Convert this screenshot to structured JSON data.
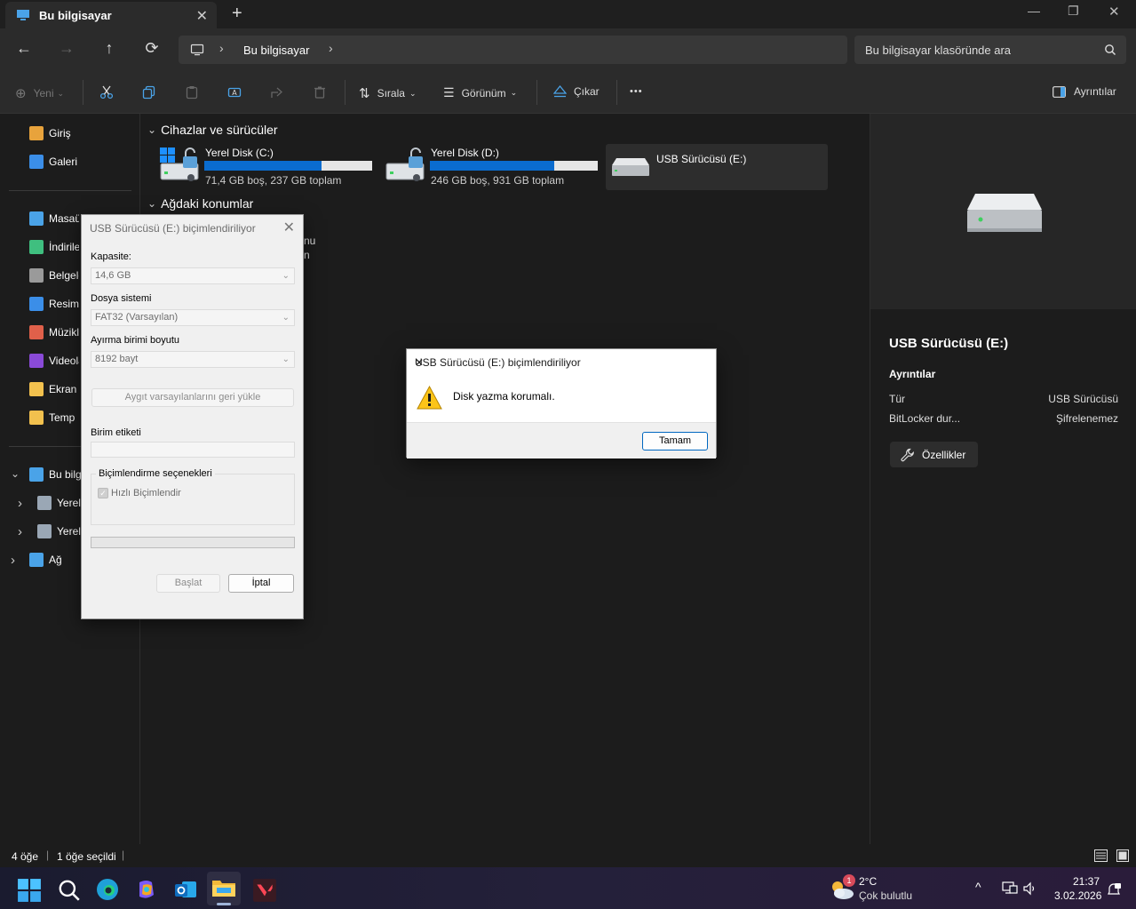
{
  "window": {
    "tab_title": "Bu bilgisayar",
    "new_tab": "+",
    "close_tab": "✕",
    "minimize": "—",
    "maximize": "❐",
    "close": "✕"
  },
  "nav": {
    "back": "←",
    "forward": "→",
    "up": "↑",
    "refresh": "⟳",
    "breadcrumb": "Bu bilgisayar",
    "search_placeholder": "Bu bilgisayar klasöründe ara"
  },
  "toolbar": {
    "new_label": "Yeni",
    "sort_label": "Sırala",
    "view_label": "Görünüm",
    "eject_label": "Çıkar",
    "more_label": "•••",
    "details_label": "Ayrıntılar"
  },
  "sidebar": {
    "top_items": [
      {
        "label": "Giriş",
        "icon": "home-icon",
        "color": "#e8a33c"
      },
      {
        "label": "Galeri",
        "icon": "gallery-icon",
        "color": "#3b8ee8"
      }
    ],
    "quick_items": [
      {
        "label": "Masaüstü",
        "icon": "desktop-icon",
        "color": "#4aa3e8"
      },
      {
        "label": "İndirilenler",
        "icon": "download-icon",
        "color": "#3fbf7f"
      },
      {
        "label": "Belgeler",
        "icon": "documents-icon",
        "color": "#9a9a9a"
      },
      {
        "label": "Resimler",
        "icon": "pictures-icon",
        "color": "#3b8ee8"
      },
      {
        "label": "Müzikler",
        "icon": "music-icon",
        "color": "#e0604a"
      },
      {
        "label": "Videolar",
        "icon": "videos-icon",
        "color": "#8a4ad8"
      },
      {
        "label": "Ekran Görüntüleri",
        "icon": "folder-icon",
        "color": "#f2c14e"
      },
      {
        "label": "Temp",
        "icon": "folder-icon",
        "color": "#f2c14e"
      }
    ],
    "tree_items": [
      {
        "label": "Bu bilgisayar",
        "icon": "computer-icon",
        "color": "#4aa3e8"
      },
      {
        "label": "Yerel Disk (C:)",
        "icon": "drive-icon",
        "color": "#9aa7b5"
      },
      {
        "label": "Yerel Disk (D:)",
        "icon": "drive-icon",
        "color": "#9aa7b5"
      },
      {
        "label": "Ağ",
        "icon": "network-icon",
        "color": "#4aa3e8"
      }
    ],
    "expand_open": "⌄",
    "expand_closed": "›"
  },
  "main": {
    "section_devices": "Cihazlar ve sürücüler",
    "section_network": "Ağdaki konumlar",
    "drives": [
      {
        "name": "Yerel Disk (C:)",
        "info": "71,4 GB boş, 237 GB toplam",
        "used_fraction": 0.7
      },
      {
        "name": "Yerel Disk (D:)",
        "info": "246 GB boş, 931 GB toplam",
        "used_fraction": 0.74
      },
      {
        "name": "USB Sürücüsü (E:)",
        "info": ""
      }
    ],
    "network_partial": [
      "nu",
      "n"
    ]
  },
  "details": {
    "title": "USB Sürücüsü (E:)",
    "section": "Ayrıntılar",
    "rows": [
      {
        "key": "Tür",
        "value": "USB Sürücüsü"
      },
      {
        "key": "BitLocker dur...",
        "value": "Şifrelenemez"
      }
    ],
    "properties_button": "Özellikler"
  },
  "status": {
    "count": "4 öğe",
    "selected": "1 öğe seçildi"
  },
  "format_dialog": {
    "title": "USB Sürücüsü (E:) biçimlendiriliyor",
    "capacity_label": "Kapasite:",
    "capacity_value": "14,6 GB",
    "fs_label": "Dosya sistemi",
    "fs_value": "FAT32 (Varsayılan)",
    "alloc_label": "Ayırma birimi boyutu",
    "alloc_value": "8192 bayt",
    "restore_button": "Aygıt varsayılanlarını geri yükle",
    "volume_label": "Birim etiketi",
    "volume_value": "",
    "options_group": "Biçimlendirme seçenekleri",
    "quick_format": "Hızlı Biçimlendir",
    "start_button": "Başlat",
    "cancel_button": "İptal",
    "progress": 0
  },
  "message_box": {
    "title": "USB Sürücüsü (E:) biçimlendiriliyor",
    "text": "Disk yazma korumalı.",
    "ok_button": "Tamam"
  },
  "taskbar": {
    "weather_temp": "2°C",
    "weather_desc": "Çok bulutlu",
    "weather_badge": "1",
    "time": "21:37",
    "date": "3.02.2026"
  }
}
